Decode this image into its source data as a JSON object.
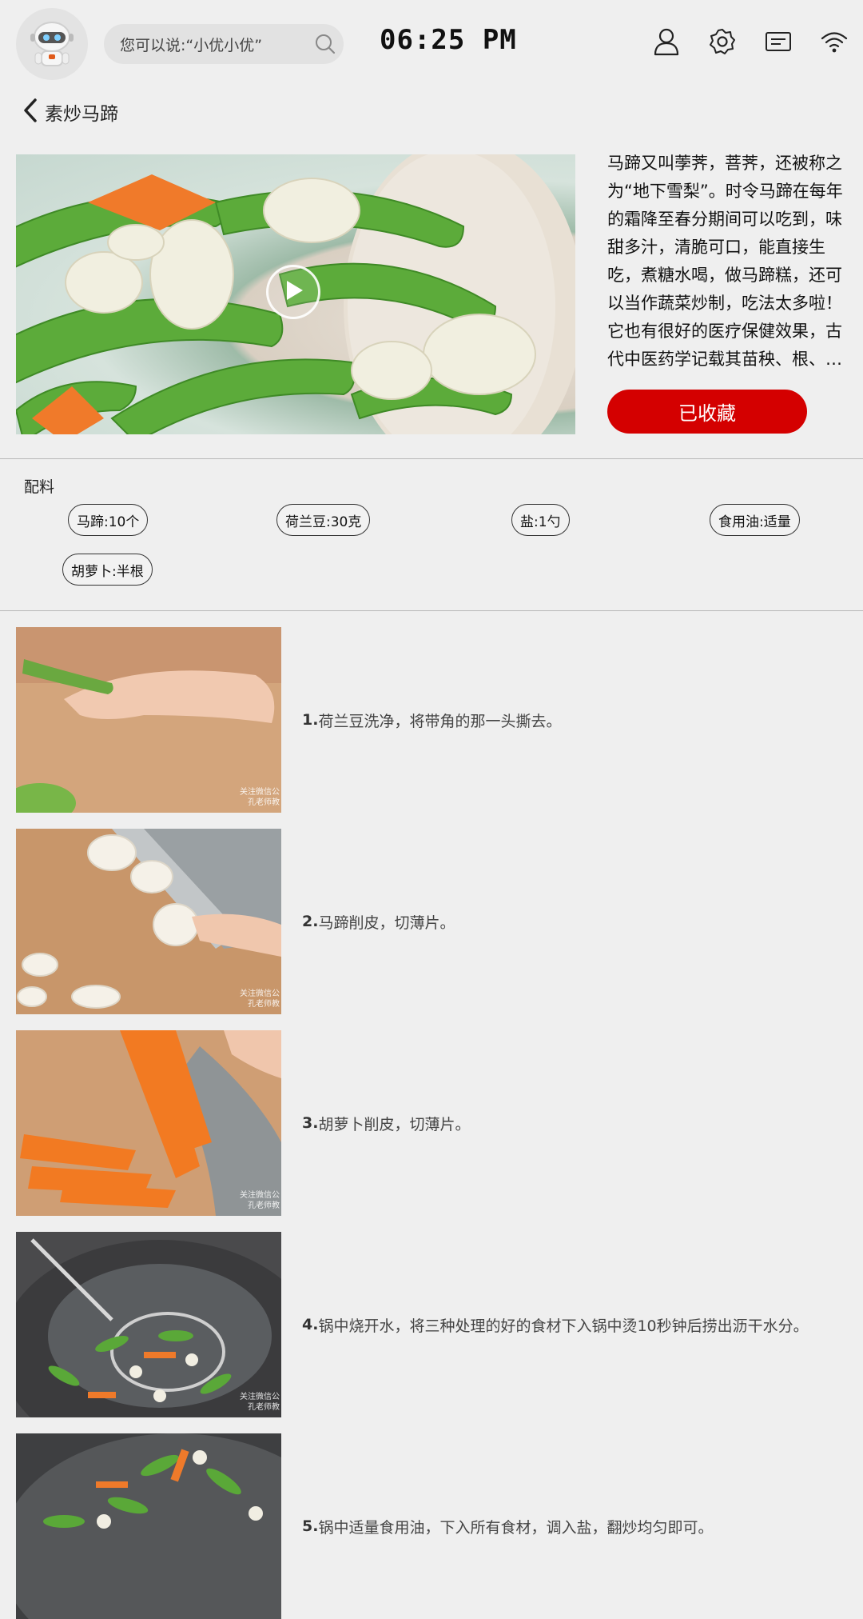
{
  "topbar": {
    "search_placeholder": "您可以说:“小优小优”",
    "time": "06:25 PM",
    "icons": [
      "robot-avatar-icon",
      "search-icon",
      "user-icon",
      "gear-icon",
      "card-icon",
      "wifi-icon"
    ]
  },
  "nav": {
    "title": "素炒马蹄"
  },
  "recipe": {
    "description": "马蹄又叫荸荠，菩荠，还被称之为“地下雪梨”。时令马蹄在每年的霜降至春分期间可以吃到，味甜多汁，清脆可口，能直接生吃，煮糖水喝，做马蹄糕，还可以当作蔬菜炒制，吃法太多啦！它也有很好的医疗保健效果，古代中医药学记载其苗秧、根、…",
    "favorite_label": "已收藏",
    "accent_color": "#d40000"
  },
  "ingredients": {
    "title": "配料",
    "items": [
      "马蹄:10个",
      "荷兰豆:30克",
      "盐:1勺",
      "食用油:适量",
      "胡萝卜:半根"
    ]
  },
  "steps": [
    {
      "num": "1.",
      "text": "荷兰豆洗净，将带角的那一头撕去。",
      "watermark": "关注微信公\n孔老师教"
    },
    {
      "num": "2.",
      "text": "马蹄削皮，切薄片。",
      "watermark": "关注微信公\n孔老师教"
    },
    {
      "num": "3.",
      "text": "胡萝卜削皮，切薄片。",
      "watermark": "关注微信公\n孔老师教"
    },
    {
      "num": "4.",
      "text": "锅中烧开水，将三种处理的好的食材下入锅中烫10秒钟后捞出沥干水分。",
      "watermark": "关注微信公\n孔老师教"
    },
    {
      "num": "5.",
      "text": "锅中适量食用油，下入所有食材，调入盐，翻炒均匀即可。",
      "watermark": ""
    }
  ]
}
